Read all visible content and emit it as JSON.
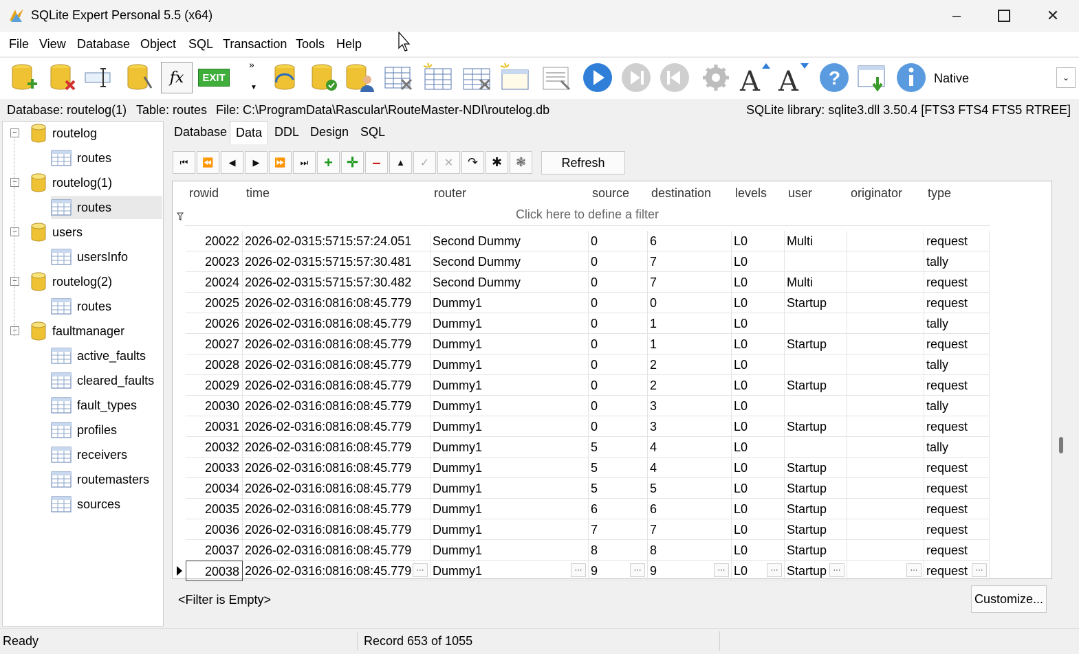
{
  "window": {
    "title": "SQLite Expert Personal 5.5 (x64)"
  },
  "menu": [
    "File",
    "View",
    "Database",
    "Object",
    "SQL",
    "Transaction",
    "Tools",
    "Help"
  ],
  "toolbar": {
    "mode_label": "Native",
    "exit_label": "EXIT",
    "fx_label": "fx"
  },
  "infobar": {
    "database": "Database: routelog(1)",
    "table": "Table: routes",
    "file": "File: C:\\ProgramData\\Rascular\\RouteMaster-NDI\\routelog.db",
    "library": "SQLite library: sqlite3.dll 3.50.4 [FTS3 FTS4 FTS5 RTREE]"
  },
  "tree": {
    "databases": [
      {
        "name": "routelog",
        "tables": [
          "routes"
        ]
      },
      {
        "name": "routelog(1)",
        "tables": [
          "routes"
        ]
      },
      {
        "name": "users",
        "tables": [
          "usersInfo"
        ]
      },
      {
        "name": "routelog(2)",
        "tables": [
          "routes"
        ]
      },
      {
        "name": "faultmanager",
        "tables": [
          "active_faults",
          "cleared_faults",
          "fault_types",
          "profiles",
          "receivers",
          "routemasters",
          "sources"
        ]
      }
    ]
  },
  "tabs": [
    "Database",
    "Data",
    "DDL",
    "Design",
    "SQL"
  ],
  "nav": {
    "refresh_label": "Refresh"
  },
  "grid": {
    "columns": [
      "rowid",
      "time",
      "router",
      "source",
      "destination",
      "levels",
      "user",
      "originator",
      "type"
    ],
    "filter_hint": "Click here to define a filter",
    "rows": [
      [
        "20022",
        "2026-02-0315:5715:57:24.051",
        "Second Dummy",
        "0",
        "6",
        "L0",
        "Multi",
        "",
        "request"
      ],
      [
        "20023",
        "2026-02-0315:5715:57:30.481",
        "Second Dummy",
        "0",
        "7",
        "L0",
        "",
        "",
        "tally"
      ],
      [
        "20024",
        "2026-02-0315:5715:57:30.482",
        "Second Dummy",
        "0",
        "7",
        "L0",
        "Multi",
        "",
        "request"
      ],
      [
        "20025",
        "2026-02-0316:0816:08:45.779",
        "Dummy1",
        "0",
        "0",
        "L0",
        "Startup",
        "",
        "request"
      ],
      [
        "20026",
        "2026-02-0316:0816:08:45.779",
        "Dummy1",
        "0",
        "1",
        "L0",
        "",
        "",
        "tally"
      ],
      [
        "20027",
        "2026-02-0316:0816:08:45.779",
        "Dummy1",
        "0",
        "1",
        "L0",
        "Startup",
        "",
        "request"
      ],
      [
        "20028",
        "2026-02-0316:0816:08:45.779",
        "Dummy1",
        "0",
        "2",
        "L0",
        "",
        "",
        "tally"
      ],
      [
        "20029",
        "2026-02-0316:0816:08:45.779",
        "Dummy1",
        "0",
        "2",
        "L0",
        "Startup",
        "",
        "request"
      ],
      [
        "20030",
        "2026-02-0316:0816:08:45.779",
        "Dummy1",
        "0",
        "3",
        "L0",
        "",
        "",
        "tally"
      ],
      [
        "20031",
        "2026-02-0316:0816:08:45.779",
        "Dummy1",
        "0",
        "3",
        "L0",
        "Startup",
        "",
        "request"
      ],
      [
        "20032",
        "2026-02-0316:0816:08:45.779",
        "Dummy1",
        "5",
        "4",
        "L0",
        "",
        "",
        "tally"
      ],
      [
        "20033",
        "2026-02-0316:0816:08:45.779",
        "Dummy1",
        "5",
        "4",
        "L0",
        "Startup",
        "",
        "request"
      ],
      [
        "20034",
        "2026-02-0316:0816:08:45.779",
        "Dummy1",
        "5",
        "5",
        "L0",
        "Startup",
        "",
        "request"
      ],
      [
        "20035",
        "2026-02-0316:0816:08:45.779",
        "Dummy1",
        "6",
        "6",
        "L0",
        "Startup",
        "",
        "request"
      ],
      [
        "20036",
        "2026-02-0316:0816:08:45.779",
        "Dummy1",
        "7",
        "7",
        "L0",
        "Startup",
        "",
        "request"
      ],
      [
        "20037",
        "2026-02-0316:0816:08:45.779",
        "Dummy1",
        "8",
        "8",
        "L0",
        "Startup",
        "",
        "request"
      ],
      [
        "20038",
        "2026-02-0316:0816:08:45.779",
        "Dummy1",
        "9",
        "9",
        "L0",
        "Startup",
        "",
        "request"
      ]
    ]
  },
  "footer": {
    "filter_status": "<Filter is Empty>",
    "customize_label": "Customize..."
  },
  "status": {
    "state": "Ready",
    "record": "Record 653 of 1055"
  }
}
